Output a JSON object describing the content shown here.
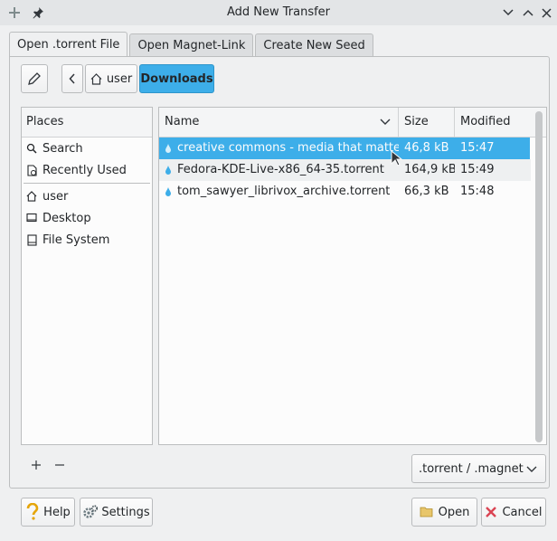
{
  "window": {
    "title": "Add New Transfer"
  },
  "tabs": [
    {
      "label": "Open .torrent File"
    },
    {
      "label": "Open Magnet-Link"
    },
    {
      "label": "Create New Seed"
    }
  ],
  "path": {
    "home": "user",
    "current": "Downloads"
  },
  "places": {
    "header": "Places",
    "items": [
      {
        "label": "Search"
      },
      {
        "label": "Recently Used"
      },
      {
        "label": "user"
      },
      {
        "label": "Desktop"
      },
      {
        "label": "File System"
      }
    ]
  },
  "files": {
    "columns": {
      "name": "Name",
      "size": "Size",
      "modified": "Modified"
    },
    "rows": [
      {
        "name": "creative commons - media that matte…",
        "size": "46,8 kB",
        "modified": "15:47"
      },
      {
        "name": "Fedora-KDE-Live-x86_64-35.torrent",
        "size": "164,9 kB",
        "modified": "15:49"
      },
      {
        "name": "tom_sawyer_librivox_archive.torrent",
        "size": "66,3 kB",
        "modified": "15:48"
      }
    ]
  },
  "filter": {
    "selected": ".torrent / .magnet"
  },
  "buttons": {
    "help": "Help",
    "settings": "Settings",
    "open": "Open",
    "cancel": "Cancel"
  },
  "colors": {
    "accent": "#3daee9",
    "cancel_x": "#da4453"
  }
}
